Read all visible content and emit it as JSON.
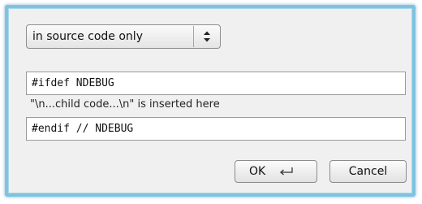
{
  "select": {
    "value": "in source code only",
    "arrows_icon": "up-down-arrows-icon"
  },
  "fields": {
    "before_value": "#ifdef NDEBUG",
    "after_value": "#endif // NDEBUG"
  },
  "note": "\"\\n...child code...\\n\" is inserted here",
  "buttons": {
    "ok_label": "OK",
    "ok_icon": "return-key-icon",
    "cancel_label": "Cancel"
  },
  "colors": {
    "frame_border": "#7ec3e0",
    "dialog_background": "#f0f0f0"
  }
}
